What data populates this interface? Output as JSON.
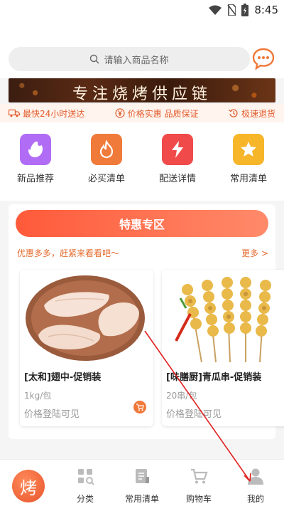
{
  "status_bar": {
    "time": "8:45"
  },
  "search": {
    "placeholder": "请输入商品名称"
  },
  "banner": {
    "text": "专注烧烤供应链"
  },
  "guarantees": [
    {
      "label": "最快24小时送达",
      "icon": "truck-icon"
    },
    {
      "label": "价格实惠 品质保证",
      "icon": "yen-icon"
    },
    {
      "label": "极速退货",
      "icon": "return-icon"
    }
  ],
  "categories": [
    {
      "label": "新品推荐",
      "color": "#b06cf5",
      "icon": "new-product-icon"
    },
    {
      "label": "必买清单",
      "color": "#f07a3a",
      "icon": "flame-icon"
    },
    {
      "label": "配送详情",
      "color": "#f04a4a",
      "icon": "lightning-icon"
    },
    {
      "label": "常用清单",
      "color": "#f7b52a",
      "icon": "star-icon"
    }
  ],
  "promo": {
    "title": "特惠专区",
    "slogan": "优惠多多，赶紧来看看吧～",
    "more": "更多 >"
  },
  "products": [
    {
      "name": "[太和]翅中-促销装",
      "unit": "1kg/包",
      "price": "价格登陆可见"
    },
    {
      "name": "[味膳厨]青瓜串-促销装",
      "unit": "20串/包",
      "price": "价格登陆可见"
    }
  ],
  "tabbar": {
    "home_glyph": "烤",
    "items": [
      {
        "label": "分类",
        "icon": "category-icon"
      },
      {
        "label": "常用清单",
        "icon": "list-icon"
      },
      {
        "label": "购物车",
        "icon": "cart-icon"
      },
      {
        "label": "我的",
        "icon": "user-icon"
      }
    ]
  },
  "colors": {
    "accent": "#ff5a3a",
    "accent_text": "#e56b2f"
  }
}
